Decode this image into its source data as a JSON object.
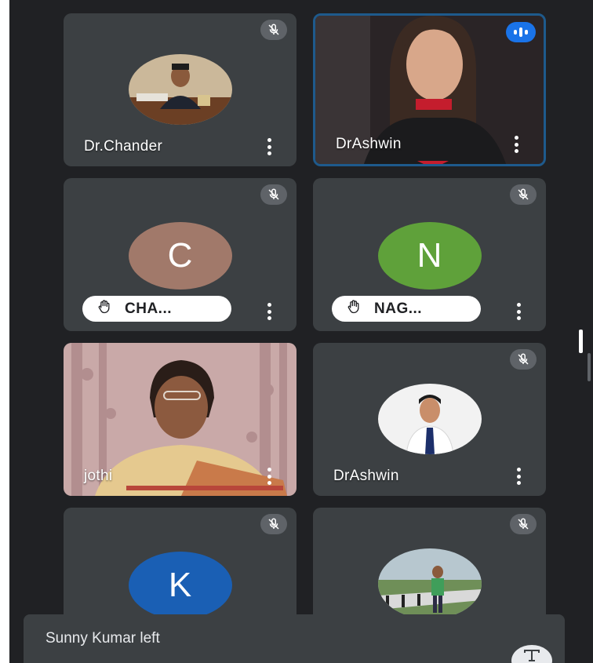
{
  "participants": [
    {
      "name": "Dr.Chander",
      "muted": true,
      "type": "photo"
    },
    {
      "name": "DrAshwin",
      "muted": false,
      "type": "video",
      "speaking": true
    },
    {
      "name": "CHA...",
      "muted": true,
      "type": "letter",
      "letter": "C",
      "color": "#a1796a",
      "hand_raised": true
    },
    {
      "name": "NAG...",
      "muted": true,
      "type": "letter",
      "letter": "N",
      "color": "#5fa13a",
      "hand_raised": true
    },
    {
      "name": "jothi",
      "muted": false,
      "type": "video"
    },
    {
      "name": "DrAshwin",
      "muted": true,
      "type": "photo"
    },
    {
      "name": "",
      "muted": true,
      "type": "letter",
      "letter": "K",
      "color": "#1a5fb4"
    },
    {
      "name": "",
      "muted": true,
      "type": "photo"
    }
  ],
  "toast": {
    "message": "Sunny Kumar left"
  },
  "icons": {
    "mute": "mic-off-icon",
    "more": "more-vert-icon",
    "hand": "raised-hand-icon",
    "speaking": "audio-level-icon",
    "captions": "captions-icon"
  },
  "colors": {
    "background": "#202124",
    "tile": "#3c4043",
    "accent": "#1a73e8"
  }
}
